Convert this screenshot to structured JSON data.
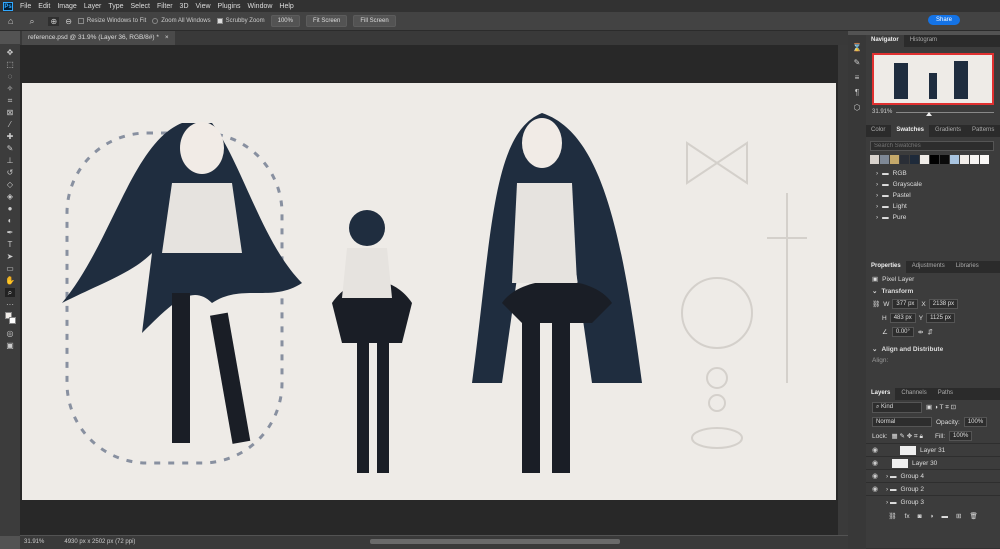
{
  "menu": {
    "logo": "Ps",
    "items": [
      "File",
      "Edit",
      "Image",
      "Layer",
      "Type",
      "Select",
      "Filter",
      "3D",
      "View",
      "Plugins",
      "Window",
      "Help"
    ]
  },
  "options": {
    "resize_windows": "Resize Windows to Fit",
    "zoom_all": "Zoom All Windows",
    "scrubby": "Scrubby Zoom",
    "btn_100": "100%",
    "fit_screen": "Fit Screen",
    "fill_screen": "Fill Screen",
    "share": "Share"
  },
  "document": {
    "tab_title": "reference.psd @ 31.9% (Layer 36, RGB/8#) *",
    "close": "×"
  },
  "status": {
    "zoom": "31.91%",
    "size": "4930 px x 2502 px (72 ppi)"
  },
  "navigator": {
    "tabs": [
      "Navigator",
      "Histogram"
    ],
    "zoom": "31.91%"
  },
  "swatches": {
    "tabs": [
      "Color",
      "Swatches",
      "Gradients",
      "Patterns"
    ],
    "search_placeholder": "Search Swatches",
    "colors": [
      "#d8d2cc",
      "#7e8896",
      "#c4a86a",
      "#2a2e36",
      "#1e2a3a",
      "#f0ece8",
      "#000000",
      "#0a0a0a",
      "#a8c4e0",
      "#f2eeea",
      "#f6f4f2",
      "#faf8f6"
    ],
    "folders": [
      "RGB",
      "Grayscale",
      "Pastel",
      "Light",
      "Pure"
    ]
  },
  "properties": {
    "tabs": [
      "Properties",
      "Adjustments",
      "Libraries"
    ],
    "layer_type": "Pixel Layer",
    "transform": "Transform",
    "w_label": "W",
    "w": "377 px",
    "h_label": "H",
    "h": "483 px",
    "x_label": "X",
    "x": "2138 px",
    "y_label": "Y",
    "y": "1125 px",
    "angle": "0.00°",
    "align": "Align and Distribute",
    "align_label": "Align:"
  },
  "layers": {
    "tabs": [
      "Layers",
      "Channels",
      "Paths"
    ],
    "kind": "Kind",
    "blend": "Normal",
    "opacity_label": "Opacity:",
    "opacity": "100%",
    "lock_label": "Lock:",
    "fill_label": "Fill:",
    "fill": "100%",
    "items": [
      {
        "name": "Layer 31",
        "type": "layer"
      },
      {
        "name": "Layer 30",
        "type": "layer"
      },
      {
        "name": "Group 4",
        "type": "group"
      },
      {
        "name": "Group 2",
        "type": "group"
      },
      {
        "name": "Group 3",
        "type": "group"
      }
    ]
  }
}
